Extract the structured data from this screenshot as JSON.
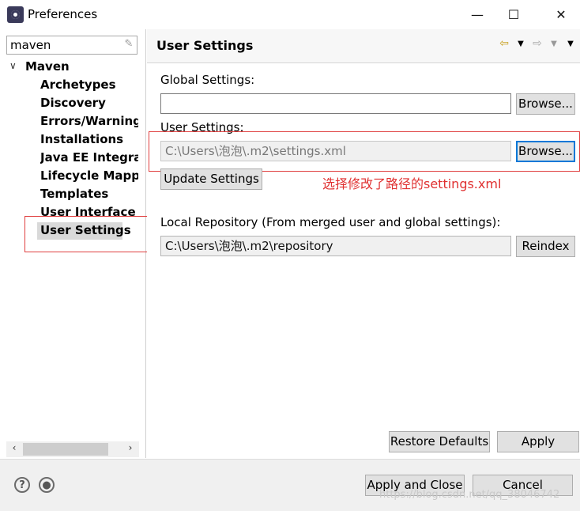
{
  "window": {
    "title": "Preferences",
    "minimize_glyph": "—",
    "maximize_glyph": "☐",
    "close_glyph": "✕"
  },
  "sidebar": {
    "filter_value": "maven",
    "tree": {
      "root_label": "Maven",
      "items": [
        {
          "label": "Archetypes"
        },
        {
          "label": "Discovery"
        },
        {
          "label": "Errors/Warnings"
        },
        {
          "label": "Installations"
        },
        {
          "label": "Java EE Integrati"
        },
        {
          "label": "Lifecycle Mappin"
        },
        {
          "label": "Templates"
        },
        {
          "label": "User Interface"
        },
        {
          "label": "User Settings",
          "selected": true
        }
      ]
    }
  },
  "page": {
    "title": "User Settings",
    "global_settings": {
      "label": "Global Settings:",
      "value": "",
      "browse_label": "Browse..."
    },
    "user_settings": {
      "label": "User Settings:",
      "value": "C:\\Users\\泡泡\\.m2\\settings.xml",
      "browse_label": "Browse..."
    },
    "update_settings_label": "Update Settings",
    "annotation": "选择修改了路径的settings.xml",
    "local_repository": {
      "label": "Local Repository (From merged user and global settings):",
      "value": "C:\\Users\\泡泡\\.m2\\repository",
      "reindex_label": "Reindex"
    },
    "restore_defaults_label": "Restore Defaults",
    "apply_label": "Apply"
  },
  "footer": {
    "apply_close_label": "Apply and Close",
    "cancel_label": "Cancel",
    "watermark": "https://blog.csdn.net/qq_38046742"
  },
  "icons": {
    "help": "help-icon",
    "settings_circle": "settings-circle-icon",
    "back": "back-arrow-icon",
    "forward": "forward-arrow-icon",
    "menu": "view-menu-icon"
  },
  "colors": {
    "annotation_red": "#e03030",
    "focus_blue": "#0078d7",
    "selection_gray": "#d9d9d9"
  }
}
